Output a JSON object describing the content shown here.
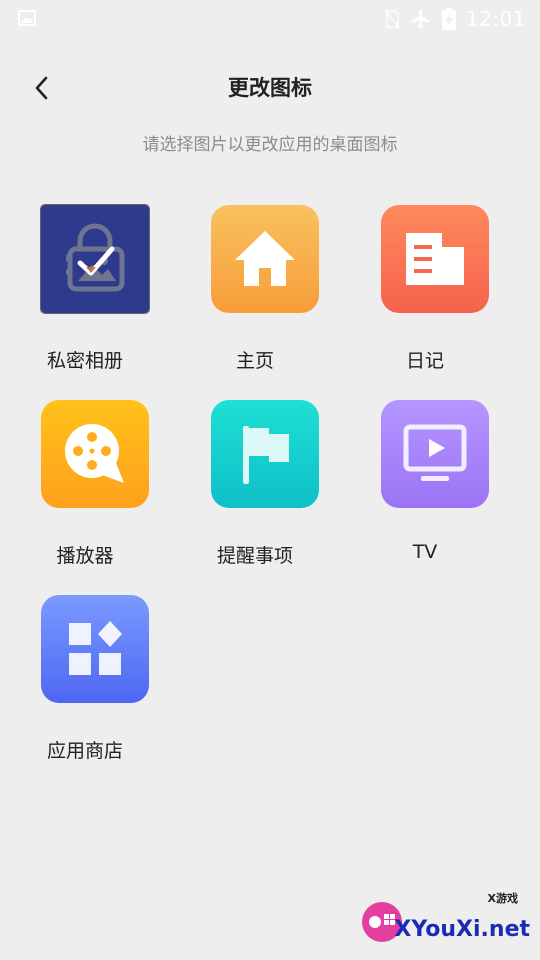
{
  "status_bar": {
    "time": "12:01",
    "icons": [
      "image-icon",
      "no-sim-icon",
      "airplane-icon",
      "battery-charging-icon"
    ]
  },
  "header": {
    "title": "更改图标",
    "subtitle": "请选择图片以更改应用的桌面图标"
  },
  "icons": [
    {
      "label": "私密相册",
      "icon": "private-album-icon",
      "selected": true,
      "colors": [
        "#2e3a8c",
        "#2e3a8c"
      ]
    },
    {
      "label": "主页",
      "icon": "home-icon",
      "selected": false,
      "colors": [
        "#f9c15e",
        "#f79d3a"
      ]
    },
    {
      "label": "日记",
      "icon": "diary-icon",
      "selected": false,
      "colors": [
        "#ff8a5c",
        "#f5624d"
      ]
    },
    {
      "label": "播放器",
      "icon": "player-icon",
      "selected": false,
      "colors": [
        "#ffc21a",
        "#ffa01c"
      ]
    },
    {
      "label": "提醒事项",
      "icon": "flag-icon",
      "selected": false,
      "colors": [
        "#1de0d4",
        "#0fbfc8"
      ]
    },
    {
      "label": "TV",
      "icon": "tv-icon",
      "selected": false,
      "colors": [
        "#b596ff",
        "#9b74f5"
      ]
    },
    {
      "label": "应用商店",
      "icon": "app-store-icon",
      "selected": false,
      "colors": [
        "#7a9bff",
        "#4e66f2"
      ]
    }
  ],
  "watermark": {
    "text": "XYouXi.net",
    "small": "X游戏"
  }
}
